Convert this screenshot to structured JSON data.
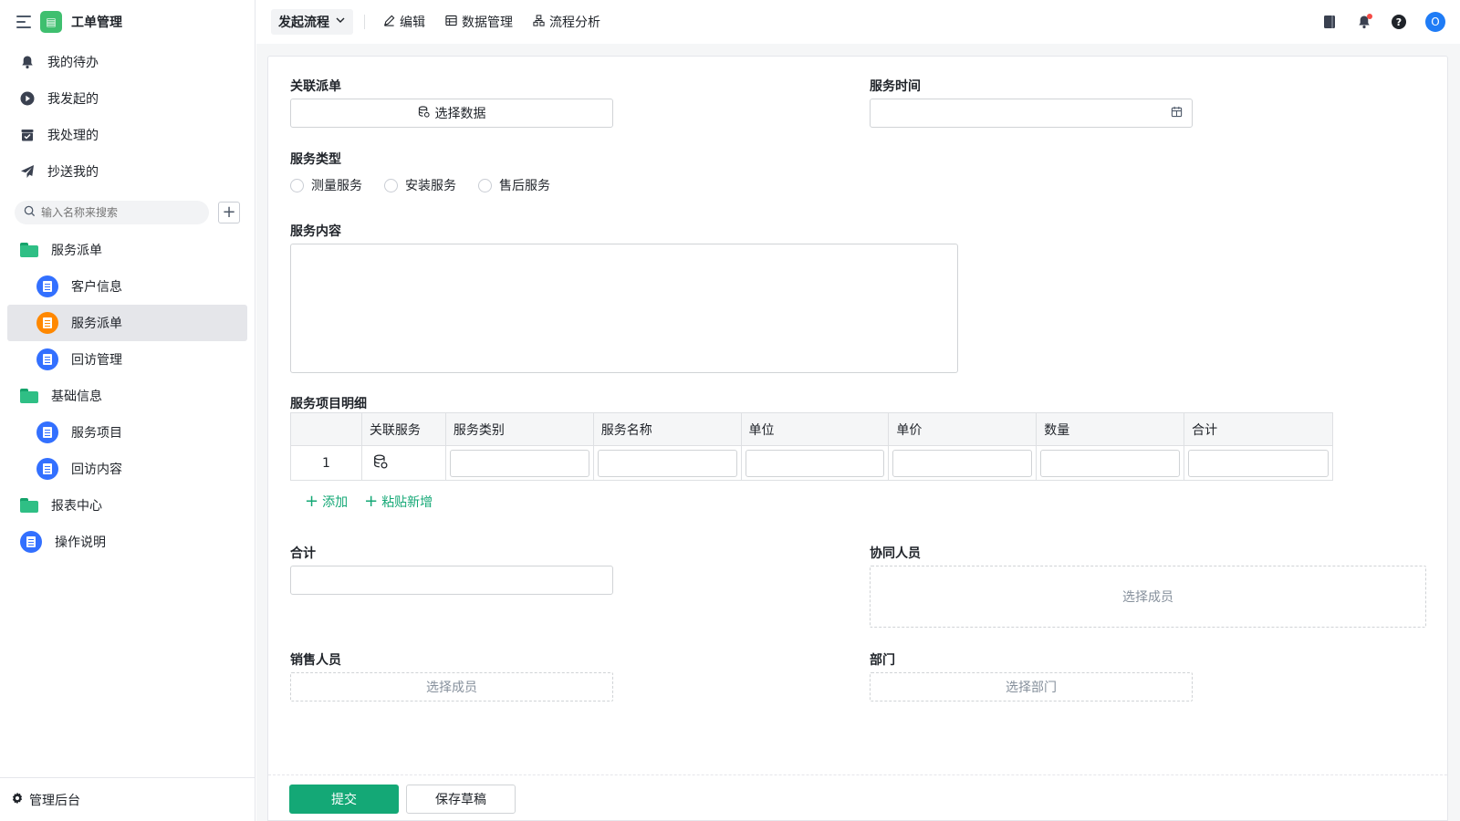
{
  "app": {
    "title": "工单管理",
    "logo_icon": "form-app-icon"
  },
  "sidebar": {
    "nav": [
      {
        "label": "我的待办",
        "icon": "bell-icon"
      },
      {
        "label": "我发起的",
        "icon": "play-circle-icon"
      },
      {
        "label": "我处理的",
        "icon": "inbox-check-icon"
      },
      {
        "label": "抄送我的",
        "icon": "send-icon"
      }
    ],
    "search_placeholder": "输入名称来搜索",
    "tree": [
      {
        "label": "服务派单",
        "type": "folder",
        "level": 0
      },
      {
        "label": "客户信息",
        "type": "form",
        "level": 1
      },
      {
        "label": "服务派单",
        "type": "flow",
        "level": 1,
        "active": true
      },
      {
        "label": "回访管理",
        "type": "form",
        "level": 1
      },
      {
        "label": "基础信息",
        "type": "folder",
        "level": 0
      },
      {
        "label": "服务项目",
        "type": "form",
        "level": 1
      },
      {
        "label": "回访内容",
        "type": "form",
        "level": 1
      },
      {
        "label": "报表中心",
        "type": "folder",
        "level": 0
      },
      {
        "label": "操作说明",
        "type": "form",
        "level": 0
      }
    ],
    "footer_label": "管理后台"
  },
  "toolbar": {
    "primary": "发起流程",
    "items": [
      {
        "label": "编辑",
        "icon": "pencil-icon"
      },
      {
        "label": "数据管理",
        "icon": "table-icon"
      },
      {
        "label": "流程分析",
        "icon": "flow-chart-icon"
      }
    ],
    "avatar_letter": "O"
  },
  "form": {
    "related_order": {
      "label": "关联派单",
      "button": "选择数据"
    },
    "service_time": {
      "label": "服务时间",
      "value": ""
    },
    "service_type": {
      "label": "服务类型",
      "options": [
        "测量服务",
        "安装服务",
        "售后服务"
      ]
    },
    "service_content": {
      "label": "服务内容",
      "value": ""
    },
    "detail": {
      "label": "服务项目明细",
      "columns": [
        "",
        "关联服务",
        "服务类别",
        "服务名称",
        "单位",
        "单价",
        "数量",
        "合计"
      ],
      "rows": [
        {
          "index": "1"
        }
      ],
      "add_label": "添加",
      "paste_label": "粘贴新增"
    },
    "total": {
      "label": "合计",
      "value": ""
    },
    "collaborators": {
      "label": "协同人员",
      "placeholder": "选择成员"
    },
    "sales": {
      "label": "销售人员",
      "placeholder": "选择成员"
    },
    "department": {
      "label": "部门",
      "placeholder": "选择部门"
    },
    "submit_label": "提交",
    "draft_label": "保存草稿"
  },
  "colors": {
    "accent": "#14a876",
    "brand_blue": "#3370ff",
    "active_orange": "#ff8800"
  }
}
